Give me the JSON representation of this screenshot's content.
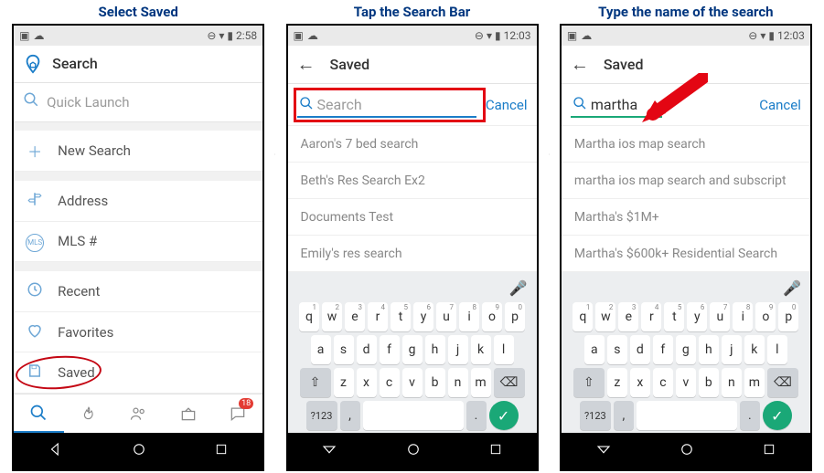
{
  "captions": [
    "Select Saved",
    "Tap the Search Bar",
    "Type the name of the search"
  ],
  "status": {
    "time_a": "2:58",
    "time_b": "12:03"
  },
  "main": {
    "title": "Search",
    "quicklaunch_placeholder": "Quick Launch",
    "rows": {
      "new_search": "New Search",
      "address": "Address",
      "mls": "MLS #",
      "recent": "Recent",
      "favorites": "Favorites",
      "saved": "Saved"
    },
    "badge": "18"
  },
  "saved": {
    "title": "Saved",
    "search_placeholder": "Search",
    "search_value": "martha",
    "cancel": "Cancel",
    "results_empty": [
      "Aaron's 7 bed search",
      "Beth's Res Search Ex2",
      "Documents Test",
      "Emily's res search"
    ],
    "results_martha": [
      "Martha ios map search",
      "martha ios map search and subscript",
      "Martha's $1M+",
      "Martha's $600k+ Residential Search"
    ]
  },
  "keyboard": {
    "row1": [
      "q",
      "w",
      "e",
      "r",
      "t",
      "y",
      "u",
      "i",
      "o",
      "p"
    ],
    "sup1": [
      "1",
      "2",
      "3",
      "4",
      "5",
      "6",
      "7",
      "8",
      "9",
      "0"
    ],
    "row2": [
      "a",
      "s",
      "d",
      "f",
      "g",
      "h",
      "j",
      "k",
      "l"
    ],
    "row3": [
      "z",
      "x",
      "c",
      "v",
      "b",
      "n",
      "m"
    ],
    "shift": "⇧",
    "backspace": "⌫",
    "sym": "?123",
    "comma": ",",
    "period": ".",
    "mic": "🎤",
    "check": "✓"
  }
}
